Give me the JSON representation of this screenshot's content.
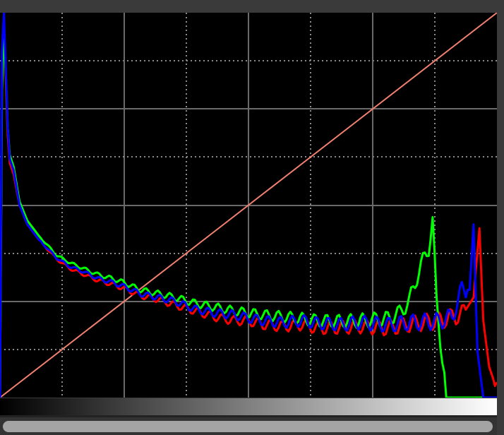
{
  "chart_data": {
    "type": "line",
    "title": "",
    "xlabel": "",
    "ylabel": "",
    "xlim": [
      0,
      255
    ],
    "ylim": [
      0,
      1
    ],
    "grid": true,
    "grid_divisions": 8,
    "colors": {
      "background": "#000000",
      "grid_major": "#6a6a6a",
      "grid_minor": "#8a8a8a",
      "curve": "#f08070"
    },
    "curve": {
      "name": "tone-curve",
      "points": [
        [
          0,
          0
        ],
        [
          255,
          1
        ]
      ]
    },
    "series": [
      {
        "name": "red",
        "color": "#ff0000",
        "points": [
          [
            0,
            0
          ],
          [
            1,
            0.85
          ],
          [
            2,
            0.97
          ],
          [
            3,
            0.82
          ],
          [
            4,
            0.68
          ],
          [
            5,
            0.61
          ],
          [
            7,
            0.58
          ],
          [
            10,
            0.5
          ],
          [
            14,
            0.45
          ],
          [
            20,
            0.41
          ],
          [
            29,
            0.36
          ],
          [
            36,
            0.335
          ],
          [
            43,
            0.32
          ],
          [
            50,
            0.305
          ],
          [
            57,
            0.295
          ],
          [
            63,
            0.285
          ],
          [
            72,
            0.265
          ],
          [
            81,
            0.255
          ],
          [
            90,
            0.24
          ],
          [
            100,
            0.225
          ],
          [
            110,
            0.21
          ],
          [
            120,
            0.2
          ],
          [
            127,
            0.2
          ],
          [
            135,
            0.19
          ],
          [
            145,
            0.185
          ],
          [
            155,
            0.19
          ],
          [
            163,
            0.18
          ],
          [
            175,
            0.182
          ],
          [
            185,
            0.185
          ],
          [
            199,
            0.18
          ],
          [
            210,
            0.19
          ],
          [
            225,
            0.2
          ],
          [
            233,
            0.21
          ],
          [
            238,
            0.22
          ],
          [
            243,
            0.26
          ],
          [
            246,
            0.44
          ],
          [
            248,
            0.2
          ],
          [
            251,
            0.08
          ],
          [
            253,
            0.05
          ],
          [
            254,
            0.03
          ],
          [
            255,
            0.04
          ]
        ]
      },
      {
        "name": "green",
        "color": "#00ff00",
        "points": [
          [
            0,
            0
          ],
          [
            1,
            0.8
          ],
          [
            2,
            0.95
          ],
          [
            3,
            0.84
          ],
          [
            4,
            0.7
          ],
          [
            5,
            0.63
          ],
          [
            7,
            0.6
          ],
          [
            10,
            0.51
          ],
          [
            14,
            0.46
          ],
          [
            20,
            0.42
          ],
          [
            29,
            0.37
          ],
          [
            36,
            0.35
          ],
          [
            43,
            0.335
          ],
          [
            50,
            0.32
          ],
          [
            57,
            0.31
          ],
          [
            63,
            0.3
          ],
          [
            72,
            0.28
          ],
          [
            81,
            0.27
          ],
          [
            90,
            0.26
          ],
          [
            100,
            0.245
          ],
          [
            110,
            0.235
          ],
          [
            120,
            0.225
          ],
          [
            127,
            0.22
          ],
          [
            135,
            0.215
          ],
          [
            145,
            0.21
          ],
          [
            155,
            0.205
          ],
          [
            163,
            0.2
          ],
          [
            175,
            0.198
          ],
          [
            185,
            0.2
          ],
          [
            199,
            0.205
          ],
          [
            205,
            0.22
          ],
          [
            210,
            0.25
          ],
          [
            215,
            0.33
          ],
          [
            220,
            0.39
          ],
          [
            222,
            0.46
          ],
          [
            224,
            0.25
          ],
          [
            226,
            0.15
          ],
          [
            228,
            0.06
          ],
          [
            229,
            0
          ],
          [
            255,
            0
          ]
        ]
      },
      {
        "name": "blue",
        "color": "#0000ff",
        "points": [
          [
            0,
            0
          ],
          [
            1,
            0.9
          ],
          [
            2,
            1.0
          ],
          [
            3,
            0.85
          ],
          [
            4,
            0.7
          ],
          [
            5,
            0.62
          ],
          [
            7,
            0.59
          ],
          [
            10,
            0.5
          ],
          [
            14,
            0.45
          ],
          [
            20,
            0.41
          ],
          [
            29,
            0.363
          ],
          [
            36,
            0.34
          ],
          [
            43,
            0.327
          ],
          [
            50,
            0.31
          ],
          [
            57,
            0.3
          ],
          [
            63,
            0.29
          ],
          [
            72,
            0.27
          ],
          [
            81,
            0.26
          ],
          [
            90,
            0.25
          ],
          [
            100,
            0.23
          ],
          [
            110,
            0.22
          ],
          [
            120,
            0.215
          ],
          [
            127,
            0.207
          ],
          [
            135,
            0.2
          ],
          [
            145,
            0.195
          ],
          [
            155,
            0.2
          ],
          [
            163,
            0.193
          ],
          [
            175,
            0.19
          ],
          [
            185,
            0.195
          ],
          [
            199,
            0.189
          ],
          [
            210,
            0.195
          ],
          [
            225,
            0.198
          ],
          [
            232,
            0.21
          ],
          [
            237,
            0.28
          ],
          [
            241,
            0.28
          ],
          [
            243,
            0.45
          ],
          [
            245,
            0.12
          ],
          [
            248,
            0
          ],
          [
            255,
            0
          ]
        ]
      }
    ]
  }
}
